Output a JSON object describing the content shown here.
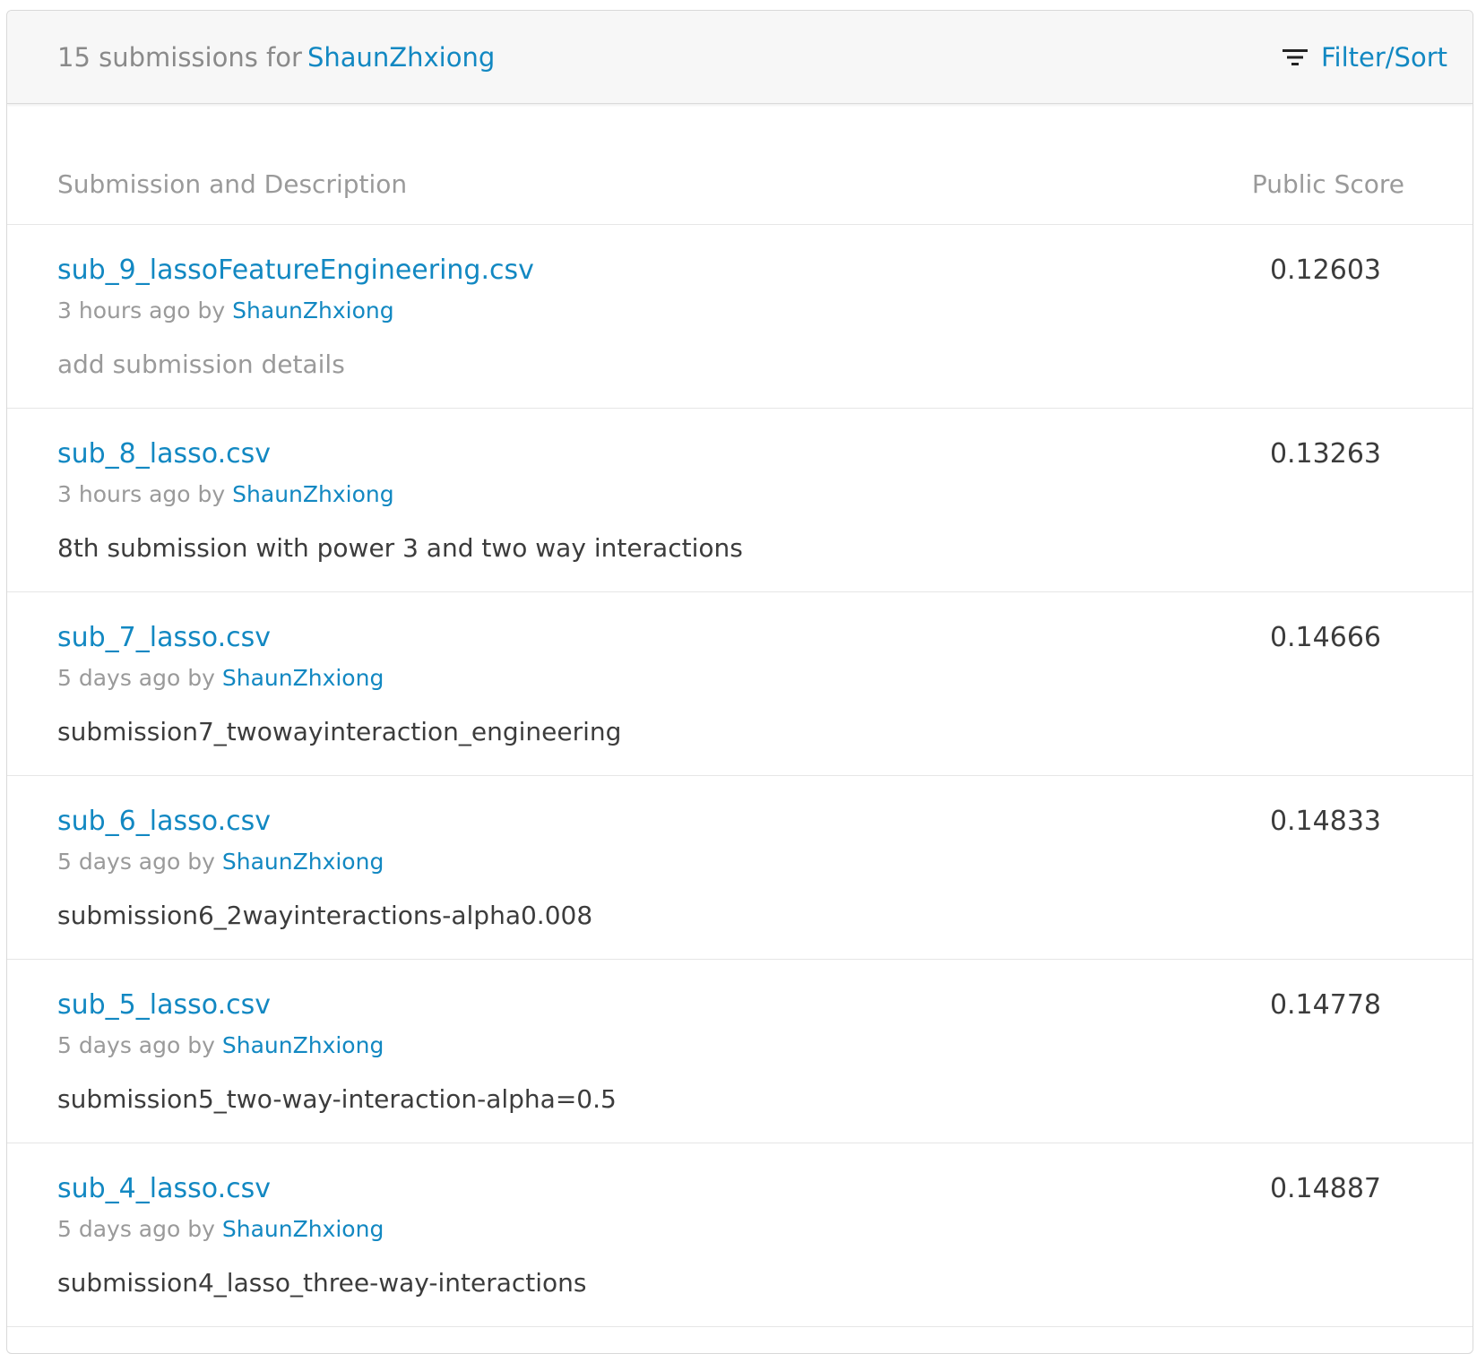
{
  "header": {
    "count_text": "15 submissions for",
    "user": "ShaunZhxiong",
    "filter_label": "Filter/Sort",
    "filter_icon": "filter-icon"
  },
  "columns": {
    "description": "Submission and Description",
    "score": "Public Score"
  },
  "rows": [
    {
      "file": "sub_9_lassoFeatureEngineering.csv",
      "time": "3 hours ago",
      "by": "by",
      "user": "ShaunZhxiong",
      "description": "add submission details",
      "score": "0.12603"
    },
    {
      "file": "sub_8_lasso.csv",
      "time": "3 hours ago",
      "by": "by",
      "user": "ShaunZhxiong",
      "description": "8th submission with power 3 and two way interactions",
      "score": "0.13263"
    },
    {
      "file": "sub_7_lasso.csv",
      "time": "5 days ago",
      "by": "by",
      "user": "ShaunZhxiong",
      "description": "submission7_twowayinteraction_engineering",
      "score": "0.14666"
    },
    {
      "file": "sub_6_lasso.csv",
      "time": "5 days ago",
      "by": "by",
      "user": "ShaunZhxiong",
      "description": "submission6_2wayinteractions-alpha0.008",
      "score": "0.14833"
    },
    {
      "file": "sub_5_lasso.csv",
      "time": "5 days ago",
      "by": "by",
      "user": "ShaunZhxiong",
      "description": "submission5_two-way-interaction-alpha=0.5",
      "score": "0.14778"
    },
    {
      "file": "sub_4_lasso.csv",
      "time": "5 days ago",
      "by": "by",
      "user": "ShaunZhxiong",
      "description": "submission4_lasso_three-way-interactions",
      "score": "0.14887"
    }
  ]
}
